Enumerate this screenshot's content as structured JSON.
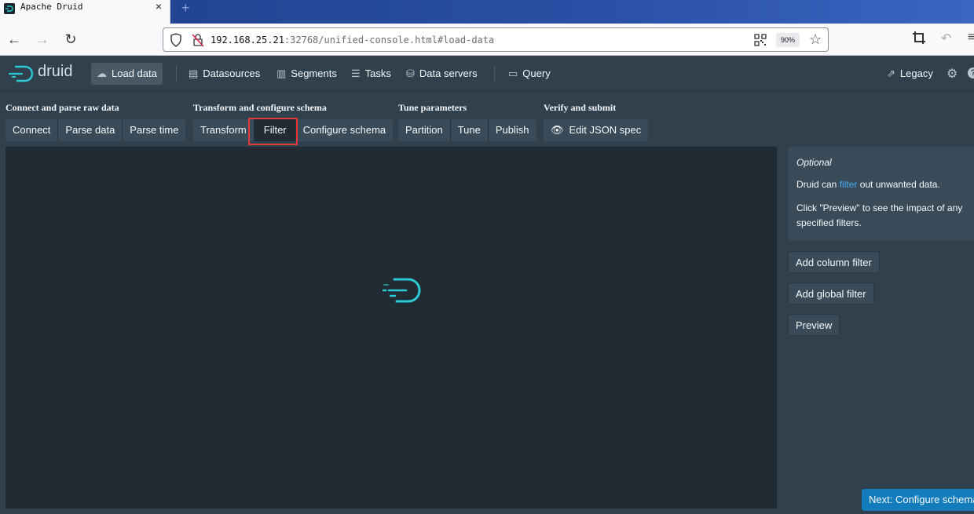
{
  "browser": {
    "tab_title": "Apache Druid",
    "tab_close": "×",
    "new_tab": "+",
    "back": "←",
    "forward": "→",
    "reload": "↻",
    "url_host": "192.168.25.21",
    "url_rest": ":32768/unified-console.html#load-data",
    "zoom": "90%",
    "bookmark": "☆",
    "undo": "↶",
    "menu": "≡"
  },
  "header": {
    "logo_text": "druid",
    "nav": [
      {
        "label": "Load data",
        "icon": "cloud-upload-icon"
      },
      {
        "label": "Datasources",
        "icon": "database-stack-icon"
      },
      {
        "label": "Segments",
        "icon": "bar-stack-icon"
      },
      {
        "label": "Tasks",
        "icon": "gantt-icon"
      },
      {
        "label": "Data servers",
        "icon": "servers-icon"
      },
      {
        "label": "Query",
        "icon": "console-icon"
      }
    ],
    "legacy": "Legacy",
    "settings_icon": "⚙",
    "help_icon": "?"
  },
  "steps": {
    "groups": [
      {
        "title": "Connect and parse raw data",
        "items": [
          "Connect",
          "Parse data",
          "Parse time"
        ]
      },
      {
        "title": "Transform and configure schema",
        "items": [
          "Transform",
          "Filter",
          "Configure schema"
        ]
      },
      {
        "title": "Tune parameters",
        "items": [
          "Partition",
          "Tune",
          "Publish"
        ]
      },
      {
        "title": "Verify and submit",
        "items": [
          "Edit JSON spec"
        ]
      }
    ],
    "active": "Filter"
  },
  "sidebar": {
    "optional": "Optional",
    "p1_before": "Druid can ",
    "p1_link": "filter",
    "p1_after": " out unwanted data.",
    "p2": "Click \"Preview\" to see the impact of any specified filters.",
    "buttons": [
      "Add column filter",
      "Add global filter",
      "Preview"
    ],
    "next": "Next: Configure schema"
  },
  "colors": {
    "background": "#30404d",
    "panel": "#202b33",
    "button": "#394b59",
    "accent": "#2ccad4",
    "primary": "#137cbd",
    "highlight": "#e03a3a"
  }
}
